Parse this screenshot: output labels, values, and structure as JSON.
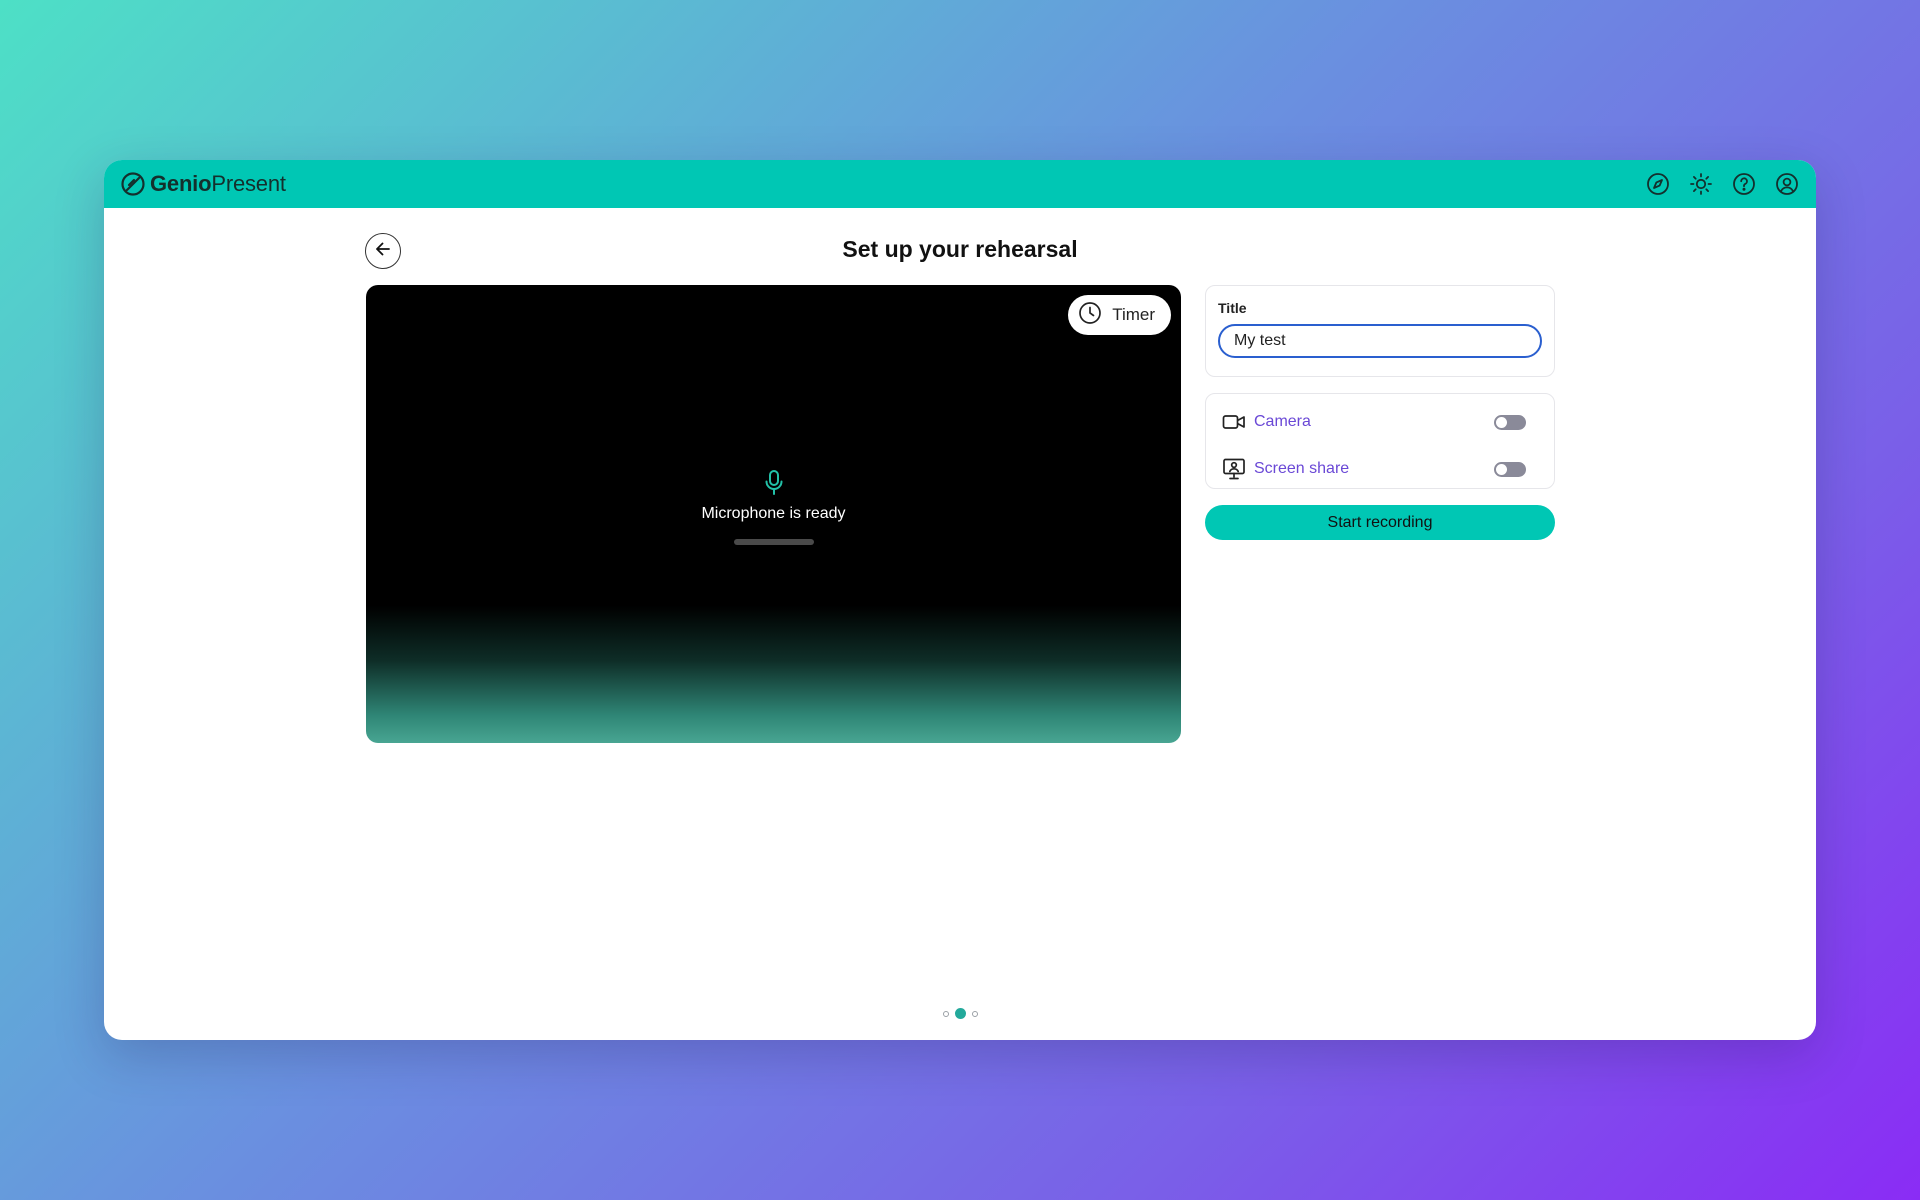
{
  "app": {
    "brand_bold": "Genio",
    "brand_light": "Present",
    "accent_color": "#00c7b4",
    "link_color": "#6a48d6",
    "header_icons": [
      "compass-icon",
      "sun-icon",
      "help-icon",
      "user-icon"
    ]
  },
  "page": {
    "title": "Set up your rehearsal",
    "back_icon": "arrow-left-icon"
  },
  "preview": {
    "timer_label": "Timer",
    "timer_icon": "clock-icon",
    "mic_icon": "microphone-icon",
    "mic_status": "Microphone is ready"
  },
  "form": {
    "title_label": "Title",
    "title_value": "My test",
    "camera_label": "Camera",
    "camera_icon": "video-camera-icon",
    "camera_enabled": false,
    "screen_label": "Screen share",
    "screen_icon": "screen-share-icon",
    "screen_enabled": false,
    "start_label": "Start recording"
  },
  "stepper": {
    "total_steps": 3,
    "current_step": 2
  }
}
